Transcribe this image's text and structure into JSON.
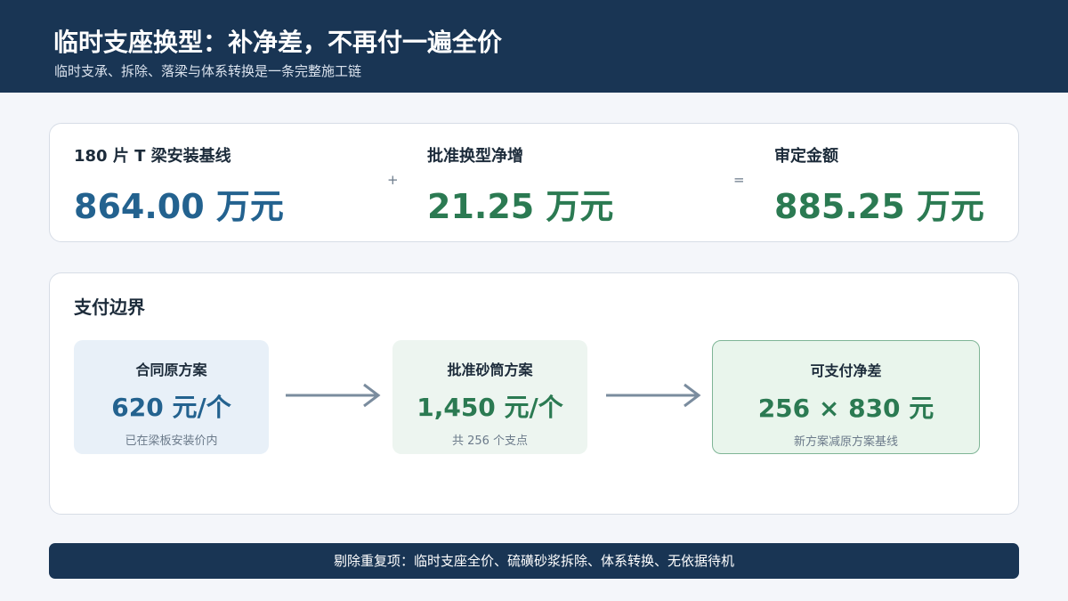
{
  "header": {
    "title": "临时支座换型：补净差，不再付一遍全价",
    "subtitle": "临时支承、拆除、落梁与体系转换是一条完整施工链"
  },
  "summary": {
    "baseline": {
      "label": "180 片 T 梁安装基线",
      "value": "864.00 万元"
    },
    "plus": "+",
    "increment": {
      "label": "批准换型净增",
      "value": "21.25 万元"
    },
    "equals": "=",
    "approved": {
      "label": "审定金额",
      "value": "885.25 万元"
    }
  },
  "boundary": {
    "title": "支付边界",
    "original": {
      "title": "合同原方案",
      "value": "620 元/个",
      "note": "已在梁板安装价内"
    },
    "approved": {
      "title": "批准砂筒方案",
      "value": "1,450 元/个",
      "note": "共 256 个支点"
    },
    "payable": {
      "title": "可支付净差",
      "value": "256 × 830 元",
      "note": "新方案减原方案基线"
    }
  },
  "footer": {
    "text": "剔除重复项：临时支座全价、硫磺砂浆拆除、体系转换、无依据待机"
  },
  "colors": {
    "navy": "#193554",
    "blue_value": "#23628f",
    "green_value": "#2b7a52",
    "arrow": "#7a8c9e"
  }
}
